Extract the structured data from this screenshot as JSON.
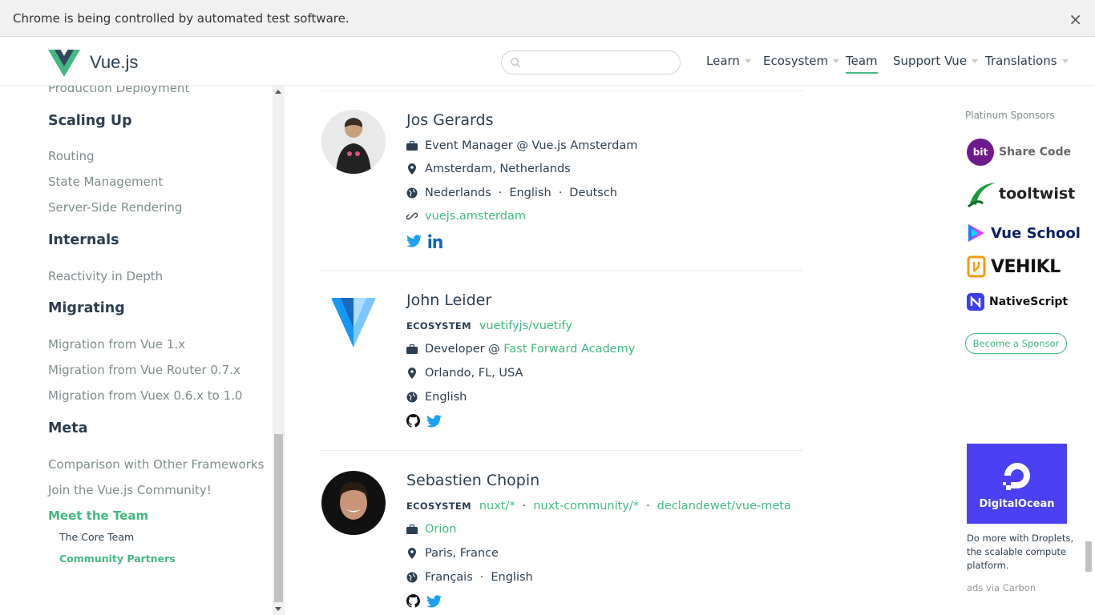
{
  "infobar": {
    "message": "Chrome is being controlled by automated test software.",
    "close": "×"
  },
  "header": {
    "logo_text": "Vue.js",
    "search_placeholder": "",
    "nav": [
      {
        "label": "Learn",
        "has_caret": true
      },
      {
        "label": "Ecosystem",
        "has_caret": true
      },
      {
        "label": "Team",
        "has_caret": false,
        "active": true
      },
      {
        "label": "Support Vue",
        "has_caret": true
      },
      {
        "label": "Translations",
        "has_caret": true
      }
    ]
  },
  "sidebar": {
    "partial_top": "Production Deployment",
    "sections": [
      {
        "title": "Scaling Up",
        "links": [
          "Routing",
          "State Management",
          "Server-Side Rendering"
        ]
      },
      {
        "title": "Internals",
        "links": [
          "Reactivity in Depth"
        ]
      },
      {
        "title": "Migrating",
        "links": [
          "Migration from Vue 1.x",
          "Migration from Vue Router 0.7.x",
          "Migration from Vuex 0.6.x to 1.0"
        ]
      },
      {
        "title": "Meta",
        "links": [
          "Comparison with Other Frameworks",
          "Join the Vue.js Community!",
          "Meet the Team"
        ]
      }
    ],
    "sub_links": [
      "The Core Team",
      "Community Partners"
    ]
  },
  "members": [
    {
      "name": "Jos Gerards",
      "work": "Event Manager @ Vue.js Amsterdam",
      "location": "Amsterdam, Netherlands",
      "languages": [
        "Nederlands",
        "English",
        "Deutsch"
      ],
      "link": "vuejs.amsterdam",
      "socials": [
        "twitter-icon",
        "linkedin-icon"
      ]
    },
    {
      "name": "John Leider",
      "ecosystem_label": "ECOSYSTEM",
      "ecosystem": [
        "vuetifyjs/vuetify"
      ],
      "work_prefix": "Developer @ ",
      "work_link": "Fast Forward Academy",
      "location": "Orlando, FL, USA",
      "languages": [
        "English"
      ],
      "socials": [
        "github-icon",
        "twitter-icon"
      ]
    },
    {
      "name": "Sebastien Chopin",
      "ecosystem_label": "ECOSYSTEM",
      "ecosystem": [
        "nuxt/*",
        "nuxt-community/*",
        "declandewet/vue-meta"
      ],
      "work_link": "Orion",
      "location": "Paris, France",
      "languages": [
        "Français",
        "English"
      ],
      "socials": [
        "github-icon",
        "twitter-icon"
      ]
    }
  ],
  "sponsors": {
    "title": "Platinum Sponsors",
    "items": [
      {
        "badge": "bit",
        "name": "Share Code"
      },
      {
        "name": "tooltwist"
      },
      {
        "name": "Vue School"
      },
      {
        "name": "VEHIKL"
      },
      {
        "name": "NativeScript"
      }
    ],
    "become": "Become a Sponsor"
  },
  "ad": {
    "brand": "DigitalOcean",
    "text": "Do more with Droplets, the scalable compute platform.",
    "via": "ads via Carbon"
  },
  "colors": {
    "accent": "#42b983",
    "text": "#2c3e50",
    "muted": "#7f8c8d",
    "ad_bg": "#4c40f5",
    "twitter": "#1da1f2",
    "linkedin": "#0a66c2"
  }
}
